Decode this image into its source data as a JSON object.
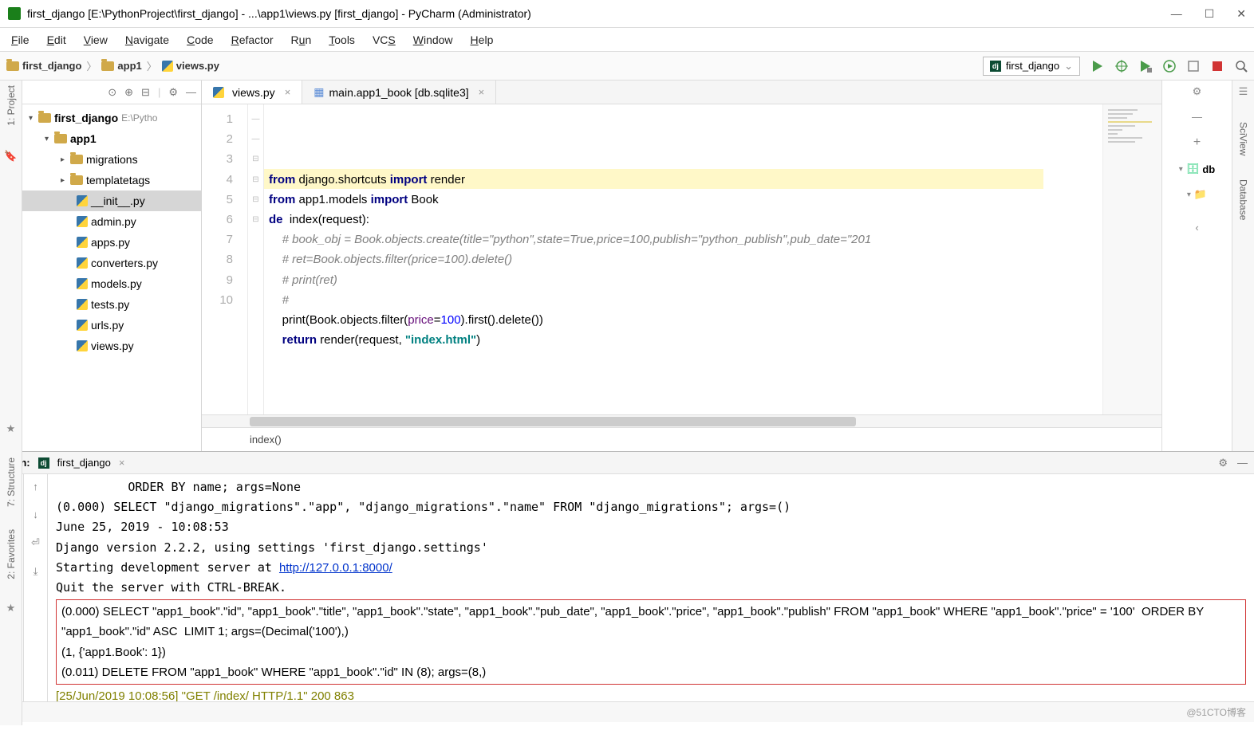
{
  "window": {
    "title": "first_django [E:\\PythonProject\\first_django] - ...\\app1\\views.py [first_django] - PyCharm (Administrator)"
  },
  "menu": [
    "File",
    "Edit",
    "View",
    "Navigate",
    "Code",
    "Refactor",
    "Run",
    "Tools",
    "VCS",
    "Window",
    "Help"
  ],
  "breadcrumb": {
    "root": "first_django",
    "mid": "app1",
    "file": "views.py"
  },
  "run_config": {
    "name": "first_django"
  },
  "tabs": [
    {
      "label": "views.py",
      "active": true,
      "icon": "py"
    },
    {
      "label": "main.app1_book [db.sqlite3]",
      "active": false,
      "icon": "table"
    }
  ],
  "tree": {
    "root": "first_django",
    "root_path": "E:\\Pytho",
    "app": "app1",
    "migrations": "migrations",
    "templatetags": "templatetags",
    "files": [
      "__init__.py",
      "admin.py",
      "apps.py",
      "converters.py",
      "models.py",
      "tests.py",
      "urls.py",
      "views.py"
    ]
  },
  "code": {
    "lines": [
      {
        "n": 1,
        "html": "<span class=\"kw\">from</span> django.shortcuts <span class=\"kw\">import</span> render"
      },
      {
        "n": 2,
        "html": "<span class=\"kw\">from</span> app1.models <span class=\"kw\">import</span> Book"
      },
      {
        "n": 3,
        "html": "<span class=\"kw\">de</span>  index(request):"
      },
      {
        "n": 4,
        "html": "    <span class=\"cm\"># book_obj = Book.objects.create(title=\"python\",state=True,price=100,publish=\"python_publish\",pub_date=\"201</span>"
      },
      {
        "n": 5,
        "html": "    <span class=\"cm\"># ret=Book.objects.filter(price=100).delete()</span>"
      },
      {
        "n": 6,
        "html": "    <span class=\"cm\"># print(ret)</span>"
      },
      {
        "n": 7,
        "html": "    <span class=\"cm\">#</span>"
      },
      {
        "n": 8,
        "html": "    print(Book.objects.filter(<span class=\"nm\">price</span>=<span class=\"num\">100</span>).first().delete())"
      },
      {
        "n": 9,
        "html": "    <span class=\"kw\">return</span> render(request, <span class=\"str\">\"index.html\"</span>)"
      },
      {
        "n": 10,
        "html": ""
      }
    ],
    "crumb": "index()"
  },
  "run": {
    "label": "Run:",
    "config": "first_django",
    "console": {
      "pre": "          ORDER BY name; args=None\n(0.000) SELECT \"django_migrations\".\"app\", \"django_migrations\".\"name\" FROM \"django_migrations\"; args=()\nJune 25, 2019 - 10:08:53\nDjango version 2.2.2, using settings 'first_django.settings'\nStarting development server at ",
      "link": "http://127.0.0.1:8000/",
      "post": "\nQuit the server with CTRL-BREAK.",
      "sql": "(0.000) SELECT \"app1_book\".\"id\", \"app1_book\".\"title\", \"app1_book\".\"state\", \"app1_book\".\"pub_date\", \"app1_book\".\"price\", \"app1_book\".\"publish\" FROM \"app1_book\" WHERE \"app1_book\".\"price\" = '100'  ORDER BY \"app1_book\".\"id\" ASC  LIMIT 1; args=(Decimal('100'),)\n(1, {'app1.Book': 1})\n(0.011) DELETE FROM \"app1_book\" WHERE \"app1_book\".\"id\" IN (8); args=(8,)",
      "http": "[25/Jun/2019 10:08:56] \"GET /index/ HTTP/1.1\" 200 863"
    }
  },
  "sidebars": {
    "project": "1: Project",
    "structure": "7: Structure",
    "favorites": "2: Favorites",
    "sciview": "SciView",
    "database": "Database",
    "db": "db"
  },
  "watermark": "@51CTO博客"
}
